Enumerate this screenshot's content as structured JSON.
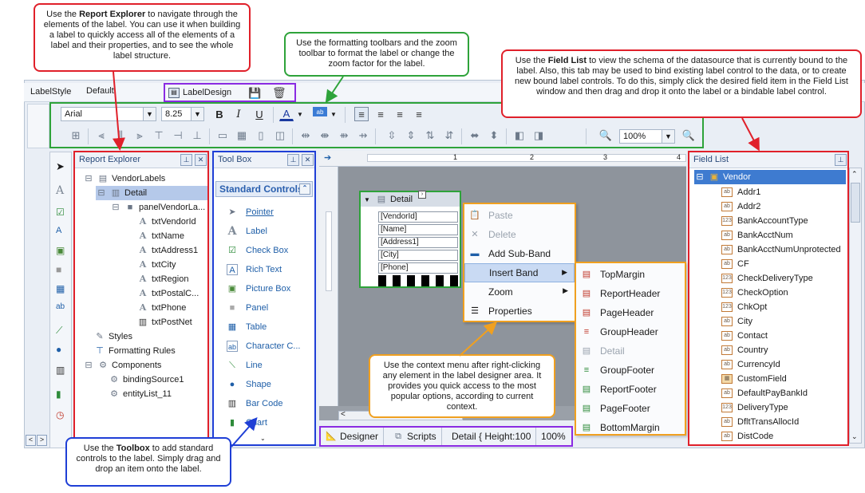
{
  "topbar": {
    "labelstyle_label": "LabelStyle",
    "labelstyle_value": "Default",
    "labeldesign_label": "LabelDesign"
  },
  "format_toolbar": {
    "font_name": "Arial",
    "font_size": "8.25",
    "bold": "B",
    "italic": "I",
    "underline": "U",
    "font_color": "A",
    "zoom_value": "100%"
  },
  "report_explorer": {
    "title": "Report Explorer",
    "items": [
      {
        "label": "VendorLabels"
      },
      {
        "label": "Detail"
      },
      {
        "label": "panelVendorLa..."
      },
      {
        "label": "txtVendorId"
      },
      {
        "label": "txtName"
      },
      {
        "label": "txtAddress1"
      },
      {
        "label": "txtCity"
      },
      {
        "label": "txtRegion"
      },
      {
        "label": "txtPostalC..."
      },
      {
        "label": "txtPhone"
      },
      {
        "label": "txtPostNet"
      },
      {
        "label": "Styles"
      },
      {
        "label": "Formatting Rules"
      },
      {
        "label": "Components"
      },
      {
        "label": "bindingSource1"
      },
      {
        "label": "entityList_11"
      }
    ]
  },
  "toolbox": {
    "title": "Tool Box",
    "section": "Standard Controls",
    "items": [
      {
        "label": "Pointer"
      },
      {
        "label": "Label"
      },
      {
        "label": "Check Box"
      },
      {
        "label": "Rich Text"
      },
      {
        "label": "Picture Box"
      },
      {
        "label": "Panel"
      },
      {
        "label": "Table"
      },
      {
        "label": "Character C..."
      },
      {
        "label": "Line"
      },
      {
        "label": "Shape"
      },
      {
        "label": "Bar Code"
      },
      {
        "label": "Chart"
      }
    ]
  },
  "designer": {
    "band_title": "Detail",
    "fields": [
      "[VendorId]",
      "[Name]",
      "[Address1]",
      "[City]",
      "[Phone]"
    ],
    "ruler_numbers": [
      "1",
      "2",
      "3",
      "4"
    ],
    "status": {
      "designer_tab": "Designer",
      "scripts_tab": "Scripts",
      "detail_info": "Detail { Height:100",
      "zoom": "100%"
    }
  },
  "context_menu": {
    "items": [
      {
        "label": "Paste",
        "disabled": true
      },
      {
        "label": "Delete",
        "disabled": true
      },
      {
        "label": "Add Sub-Band",
        "disabled": false
      },
      {
        "label": "Insert Band",
        "disabled": false
      },
      {
        "label": "Zoom",
        "disabled": false
      },
      {
        "label": "Properties",
        "disabled": false
      }
    ],
    "submenu": [
      {
        "label": "TopMargin",
        "disabled": false
      },
      {
        "label": "ReportHeader",
        "disabled": false
      },
      {
        "label": "PageHeader",
        "disabled": false
      },
      {
        "label": "GroupHeader",
        "disabled": false
      },
      {
        "label": "Detail",
        "disabled": true
      },
      {
        "label": "GroupFooter",
        "disabled": false
      },
      {
        "label": "ReportFooter",
        "disabled": false
      },
      {
        "label": "PageFooter",
        "disabled": false
      },
      {
        "label": "BottomMargin",
        "disabled": false
      }
    ]
  },
  "field_list": {
    "title": "Field List",
    "root": "Vendor",
    "items": [
      {
        "label": "Addr1",
        "type": "ab"
      },
      {
        "label": "Addr2",
        "type": "ab"
      },
      {
        "label": "BankAccountType",
        "type": "123"
      },
      {
        "label": "BankAcctNum",
        "type": "ab"
      },
      {
        "label": "BankAcctNumUnprotected",
        "type": "ab"
      },
      {
        "label": "CF",
        "type": "ab"
      },
      {
        "label": "CheckDeliveryType",
        "type": "123"
      },
      {
        "label": "CheckOption",
        "type": "123"
      },
      {
        "label": "ChkOpt",
        "type": "123"
      },
      {
        "label": "City",
        "type": "ab"
      },
      {
        "label": "Contact",
        "type": "ab"
      },
      {
        "label": "Country",
        "type": "ab"
      },
      {
        "label": "CurrencyId",
        "type": "ab"
      },
      {
        "label": "CustomField",
        "type": "grid"
      },
      {
        "label": "DefaultPayBankId",
        "type": "ab"
      },
      {
        "label": "DeliveryType",
        "type": "123"
      },
      {
        "label": "DfltTransAllocId",
        "type": "ab"
      },
      {
        "label": "DistCode",
        "type": "ab"
      }
    ]
  },
  "callouts": {
    "report_explorer_pre": "Use the ",
    "report_explorer_bold": "Report Explorer",
    "report_explorer_post": " to navigate through the elements of the label. You can use it when building a label to quickly access all of the elements of a label and their properties, and to see the whole label structure.",
    "toolbars": "Use the formatting toolbars and the zoom toolbar to format the label or change the zoom factor for the label.",
    "field_list_pre": "Use the ",
    "field_list_bold": "Field List",
    "field_list_post": " to view the schema of the datasource that is currently bound to the label. Also, this tab may be used to bind existing label control to the data, or to create new bound label controls. To do this, simply click the desired field item in the Field List window and then drag and drop it onto the label or a bindable label control.",
    "context_menu": "Use the context menu after right-clicking any element in the label designer area. It provides you quick access to the most popular options, according to current context.",
    "toolbox_pre": "Use the ",
    "toolbox_bold": "Toolbox",
    "toolbox_post": " to add standard controls to the label. Simply drag and drop an item onto the label."
  },
  "colors": {
    "callout_red": "#e0202a",
    "callout_green": "#2ea33a",
    "callout_blue": "#1f3fd6",
    "callout_orange": "#f0a020",
    "callout_purple": "#8a2be2",
    "selection": "#b5c9ea"
  }
}
